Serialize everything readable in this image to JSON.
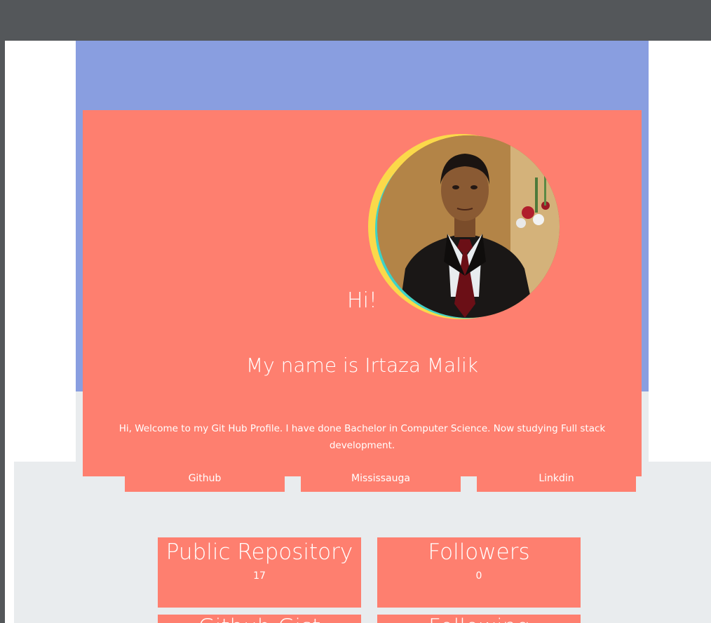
{
  "profile": {
    "greeting": "Hi!",
    "name_line": "My name is Irtaza Malik",
    "bio": "Hi, Welcome to my Git Hub Profile. I have done Bachelor in Computer Science. Now studying Full stack development."
  },
  "links": [
    {
      "label": "Github"
    },
    {
      "label": "Mississauga"
    },
    {
      "label": "Linkdin"
    }
  ],
  "stats": [
    {
      "title": "Public Repository",
      "value": "17"
    },
    {
      "title": "Followers",
      "value": "0"
    },
    {
      "title": "Github Gist",
      "value": ""
    },
    {
      "title": "Following",
      "value": ""
    }
  ],
  "colors": {
    "banner": "#899ee0",
    "card": "#fe7f6f",
    "page_bg": "#e9ecee",
    "ring_yellow": "#fbd94a",
    "ring_teal": "#3fd2c7",
    "chrome": "#54575a"
  }
}
